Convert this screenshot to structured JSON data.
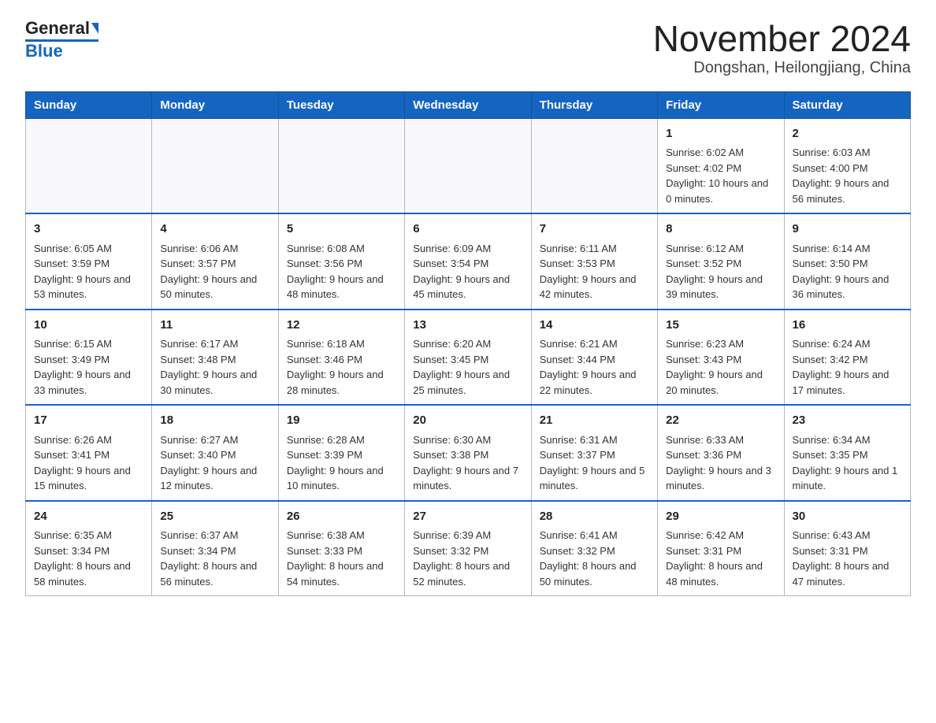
{
  "logo": {
    "name1": "General",
    "name2": "Blue"
  },
  "title": "November 2024",
  "subtitle": "Dongshan, Heilongjiang, China",
  "days_of_week": [
    "Sunday",
    "Monday",
    "Tuesday",
    "Wednesday",
    "Thursday",
    "Friday",
    "Saturday"
  ],
  "weeks": [
    [
      {
        "day": "",
        "info": ""
      },
      {
        "day": "",
        "info": ""
      },
      {
        "day": "",
        "info": ""
      },
      {
        "day": "",
        "info": ""
      },
      {
        "day": "",
        "info": ""
      },
      {
        "day": "1",
        "info": "Sunrise: 6:02 AM\nSunset: 4:02 PM\nDaylight: 10 hours and 0 minutes."
      },
      {
        "day": "2",
        "info": "Sunrise: 6:03 AM\nSunset: 4:00 PM\nDaylight: 9 hours and 56 minutes."
      }
    ],
    [
      {
        "day": "3",
        "info": "Sunrise: 6:05 AM\nSunset: 3:59 PM\nDaylight: 9 hours and 53 minutes."
      },
      {
        "day": "4",
        "info": "Sunrise: 6:06 AM\nSunset: 3:57 PM\nDaylight: 9 hours and 50 minutes."
      },
      {
        "day": "5",
        "info": "Sunrise: 6:08 AM\nSunset: 3:56 PM\nDaylight: 9 hours and 48 minutes."
      },
      {
        "day": "6",
        "info": "Sunrise: 6:09 AM\nSunset: 3:54 PM\nDaylight: 9 hours and 45 minutes."
      },
      {
        "day": "7",
        "info": "Sunrise: 6:11 AM\nSunset: 3:53 PM\nDaylight: 9 hours and 42 minutes."
      },
      {
        "day": "8",
        "info": "Sunrise: 6:12 AM\nSunset: 3:52 PM\nDaylight: 9 hours and 39 minutes."
      },
      {
        "day": "9",
        "info": "Sunrise: 6:14 AM\nSunset: 3:50 PM\nDaylight: 9 hours and 36 minutes."
      }
    ],
    [
      {
        "day": "10",
        "info": "Sunrise: 6:15 AM\nSunset: 3:49 PM\nDaylight: 9 hours and 33 minutes."
      },
      {
        "day": "11",
        "info": "Sunrise: 6:17 AM\nSunset: 3:48 PM\nDaylight: 9 hours and 30 minutes."
      },
      {
        "day": "12",
        "info": "Sunrise: 6:18 AM\nSunset: 3:46 PM\nDaylight: 9 hours and 28 minutes."
      },
      {
        "day": "13",
        "info": "Sunrise: 6:20 AM\nSunset: 3:45 PM\nDaylight: 9 hours and 25 minutes."
      },
      {
        "day": "14",
        "info": "Sunrise: 6:21 AM\nSunset: 3:44 PM\nDaylight: 9 hours and 22 minutes."
      },
      {
        "day": "15",
        "info": "Sunrise: 6:23 AM\nSunset: 3:43 PM\nDaylight: 9 hours and 20 minutes."
      },
      {
        "day": "16",
        "info": "Sunrise: 6:24 AM\nSunset: 3:42 PM\nDaylight: 9 hours and 17 minutes."
      }
    ],
    [
      {
        "day": "17",
        "info": "Sunrise: 6:26 AM\nSunset: 3:41 PM\nDaylight: 9 hours and 15 minutes."
      },
      {
        "day": "18",
        "info": "Sunrise: 6:27 AM\nSunset: 3:40 PM\nDaylight: 9 hours and 12 minutes."
      },
      {
        "day": "19",
        "info": "Sunrise: 6:28 AM\nSunset: 3:39 PM\nDaylight: 9 hours and 10 minutes."
      },
      {
        "day": "20",
        "info": "Sunrise: 6:30 AM\nSunset: 3:38 PM\nDaylight: 9 hours and 7 minutes."
      },
      {
        "day": "21",
        "info": "Sunrise: 6:31 AM\nSunset: 3:37 PM\nDaylight: 9 hours and 5 minutes."
      },
      {
        "day": "22",
        "info": "Sunrise: 6:33 AM\nSunset: 3:36 PM\nDaylight: 9 hours and 3 minutes."
      },
      {
        "day": "23",
        "info": "Sunrise: 6:34 AM\nSunset: 3:35 PM\nDaylight: 9 hours and 1 minute."
      }
    ],
    [
      {
        "day": "24",
        "info": "Sunrise: 6:35 AM\nSunset: 3:34 PM\nDaylight: 8 hours and 58 minutes."
      },
      {
        "day": "25",
        "info": "Sunrise: 6:37 AM\nSunset: 3:34 PM\nDaylight: 8 hours and 56 minutes."
      },
      {
        "day": "26",
        "info": "Sunrise: 6:38 AM\nSunset: 3:33 PM\nDaylight: 8 hours and 54 minutes."
      },
      {
        "day": "27",
        "info": "Sunrise: 6:39 AM\nSunset: 3:32 PM\nDaylight: 8 hours and 52 minutes."
      },
      {
        "day": "28",
        "info": "Sunrise: 6:41 AM\nSunset: 3:32 PM\nDaylight: 8 hours and 50 minutes."
      },
      {
        "day": "29",
        "info": "Sunrise: 6:42 AM\nSunset: 3:31 PM\nDaylight: 8 hours and 48 minutes."
      },
      {
        "day": "30",
        "info": "Sunrise: 6:43 AM\nSunset: 3:31 PM\nDaylight: 8 hours and 47 minutes."
      }
    ]
  ]
}
